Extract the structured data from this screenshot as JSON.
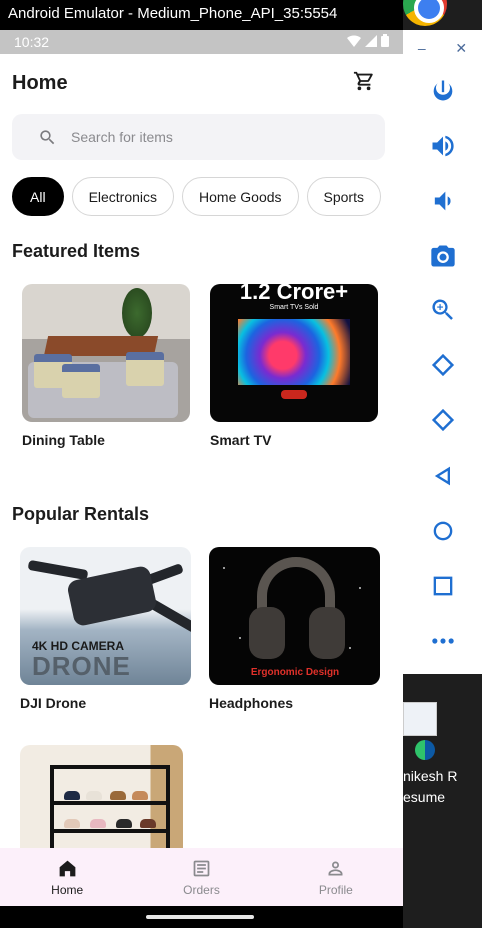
{
  "window": {
    "title": "Android Emulator - Medium_Phone_API_35:5554"
  },
  "status_bar": {
    "time": "10:32"
  },
  "header": {
    "title": "Home"
  },
  "search": {
    "placeholder": "Search for items"
  },
  "categories": [
    "All",
    "Electronics",
    "Home Goods",
    "Sports"
  ],
  "featured": {
    "title": "Featured Items",
    "items": [
      {
        "label": "Dining Table"
      },
      {
        "label": "Smart TV",
        "image_text": "1.2 Crore+",
        "image_subtext": "Smart TVs Sold"
      }
    ]
  },
  "popular": {
    "title": "Popular Rentals",
    "items": [
      {
        "label": "DJI Drone",
        "image_text_1": "4K HD CAMERA",
        "image_text_2": "DRONE"
      },
      {
        "label": "Headphones",
        "image_text": "Ergonomic Design"
      },
      {
        "label": ""
      }
    ]
  },
  "bottom_nav": {
    "items": [
      {
        "label": "Home",
        "icon": "home-icon",
        "active": true
      },
      {
        "label": "Orders",
        "icon": "orders-icon",
        "active": false
      },
      {
        "label": "Profile",
        "icon": "profile-icon",
        "active": false
      }
    ]
  },
  "desktop": {
    "file_caption": "nikesh R\nesume"
  },
  "emulator_tools": [
    "power-icon",
    "volume-up-icon",
    "volume-down-icon",
    "camera-icon",
    "zoom-icon",
    "rotate-left-icon",
    "rotate-right-icon",
    "back-icon",
    "home-circle-icon",
    "overview-icon",
    "more-icon"
  ],
  "colors": {
    "accent_active_chip": "#000000",
    "bottom_nav_bg": "#fcf0fa",
    "tool_icon": "#1f6fd1"
  }
}
